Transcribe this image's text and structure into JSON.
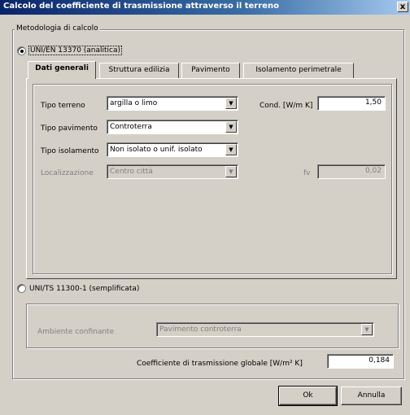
{
  "window": {
    "title": "Calcolo del coefficiente di trasmissione attraverso il terreno",
    "close_glyph": "x"
  },
  "method_group": {
    "legend": "Metodologia di calcolo",
    "option_analytic": {
      "label": "UNI/EN 13370 (analitica)",
      "selected": true
    },
    "option_simplified": {
      "label": "UNI/TS 11300-1 (semplificata)",
      "selected": false
    }
  },
  "tabs": [
    {
      "label": "Dati generali",
      "active": true
    },
    {
      "label": "Struttura edilizia",
      "active": false
    },
    {
      "label": "Pavimento",
      "active": false
    },
    {
      "label": "Isolamento perimetrale",
      "active": false
    }
  ],
  "general": {
    "tipo_terreno": {
      "label": "Tipo terreno",
      "value": "argilla o limo"
    },
    "tipo_pavimento": {
      "label": "Tipo pavimento",
      "value": "Controterra"
    },
    "tipo_isolamento": {
      "label": "Tipo isolamento",
      "value": "Non isolato o unif. isolato"
    },
    "localizzazione": {
      "label": "Localizzazione",
      "value": "Centro città",
      "disabled": true
    },
    "cond": {
      "label": "Cond. [W/m K]",
      "value": "1,50"
    },
    "fv": {
      "label": "fv",
      "value": "0,02",
      "disabled": true
    }
  },
  "simplified": {
    "ambiente": {
      "label": "Ambiente confinante",
      "value": "Pavimento controterra",
      "disabled": true
    }
  },
  "global": {
    "label": "Coefficiente di trasmissione globale [W/m² K]",
    "value": "0,184"
  },
  "buttons": {
    "ok": "Ok",
    "cancel": "Annulla"
  },
  "icons": {
    "dropdown": "▼"
  }
}
